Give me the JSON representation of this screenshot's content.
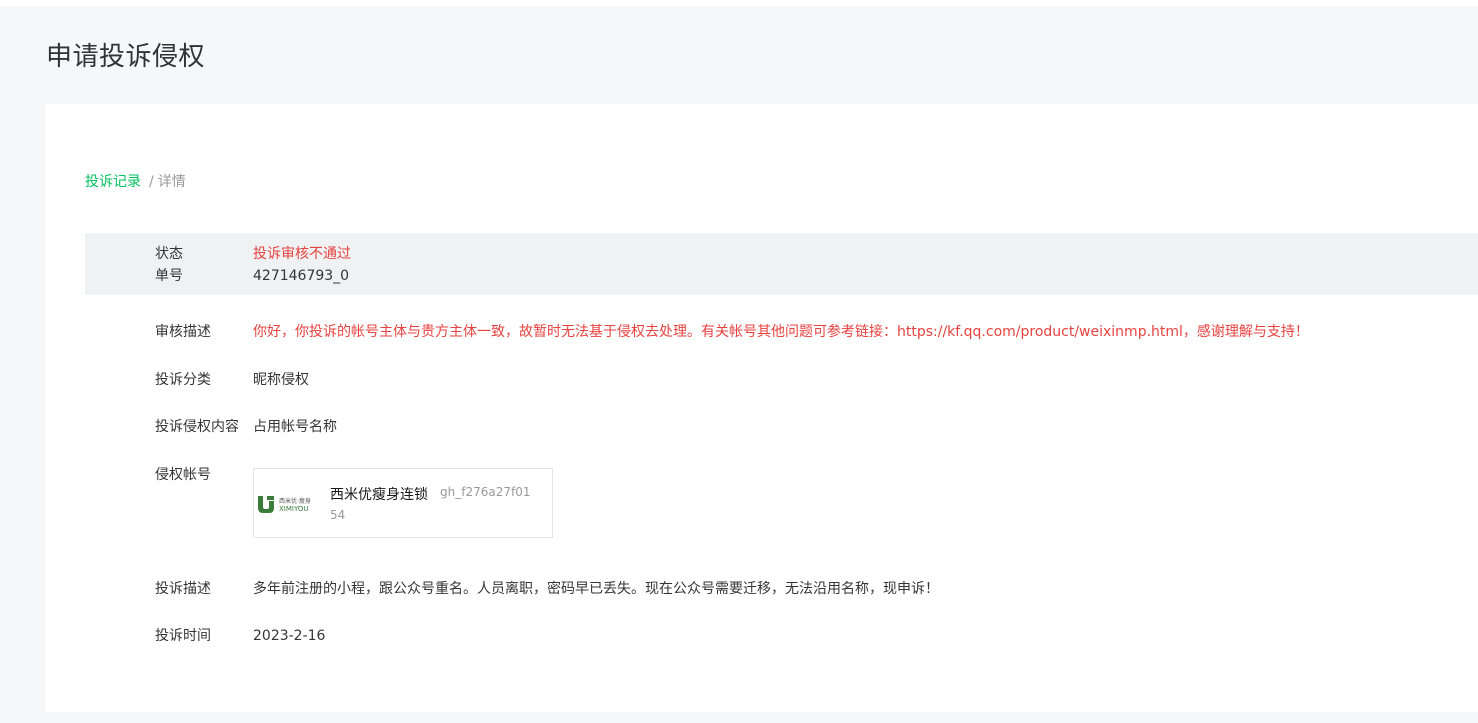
{
  "page": {
    "title": "申请投诉侵权"
  },
  "breadcrumb": {
    "link": "投诉记录",
    "separator": "/",
    "current": "详情"
  },
  "status": {
    "status_label": "状态",
    "status_value": "投诉审核不通过",
    "number_label": "单号",
    "number_value": "427146793_0"
  },
  "details": {
    "review_label": "审核描述",
    "review_value": "你好，你投诉的帐号主体与贵方主体一致，故暂时无法基于侵权去处理。有关帐号其他问题可参考链接：https://kf.qq.com/product/weixinmp.html，感谢理解与支持！",
    "category_label": "投诉分类",
    "category_value": "昵称侵权",
    "content_label": "投诉侵权内容",
    "content_value": "占用帐号名称",
    "account_label": "侵权帐号",
    "desc_label": "投诉描述",
    "desc_value": "多年前注册的小程，跟公众号重名。人员离职，密码早已丢失。现在公众号需要迁移，无法沿用名称，现申诉！",
    "time_label": "投诉时间",
    "time_value": "2023-2-16"
  },
  "account": {
    "name": "西米优瘦身连锁",
    "id_line1": "gh_f276a27f01",
    "id_line2": "54",
    "logo_text_cn": "西米优·瘦身",
    "logo_text_en": "XIMIYOU",
    "logo_color": "#3a7d3a"
  },
  "colors": {
    "accent": "#07c160",
    "error": "#e64340"
  }
}
